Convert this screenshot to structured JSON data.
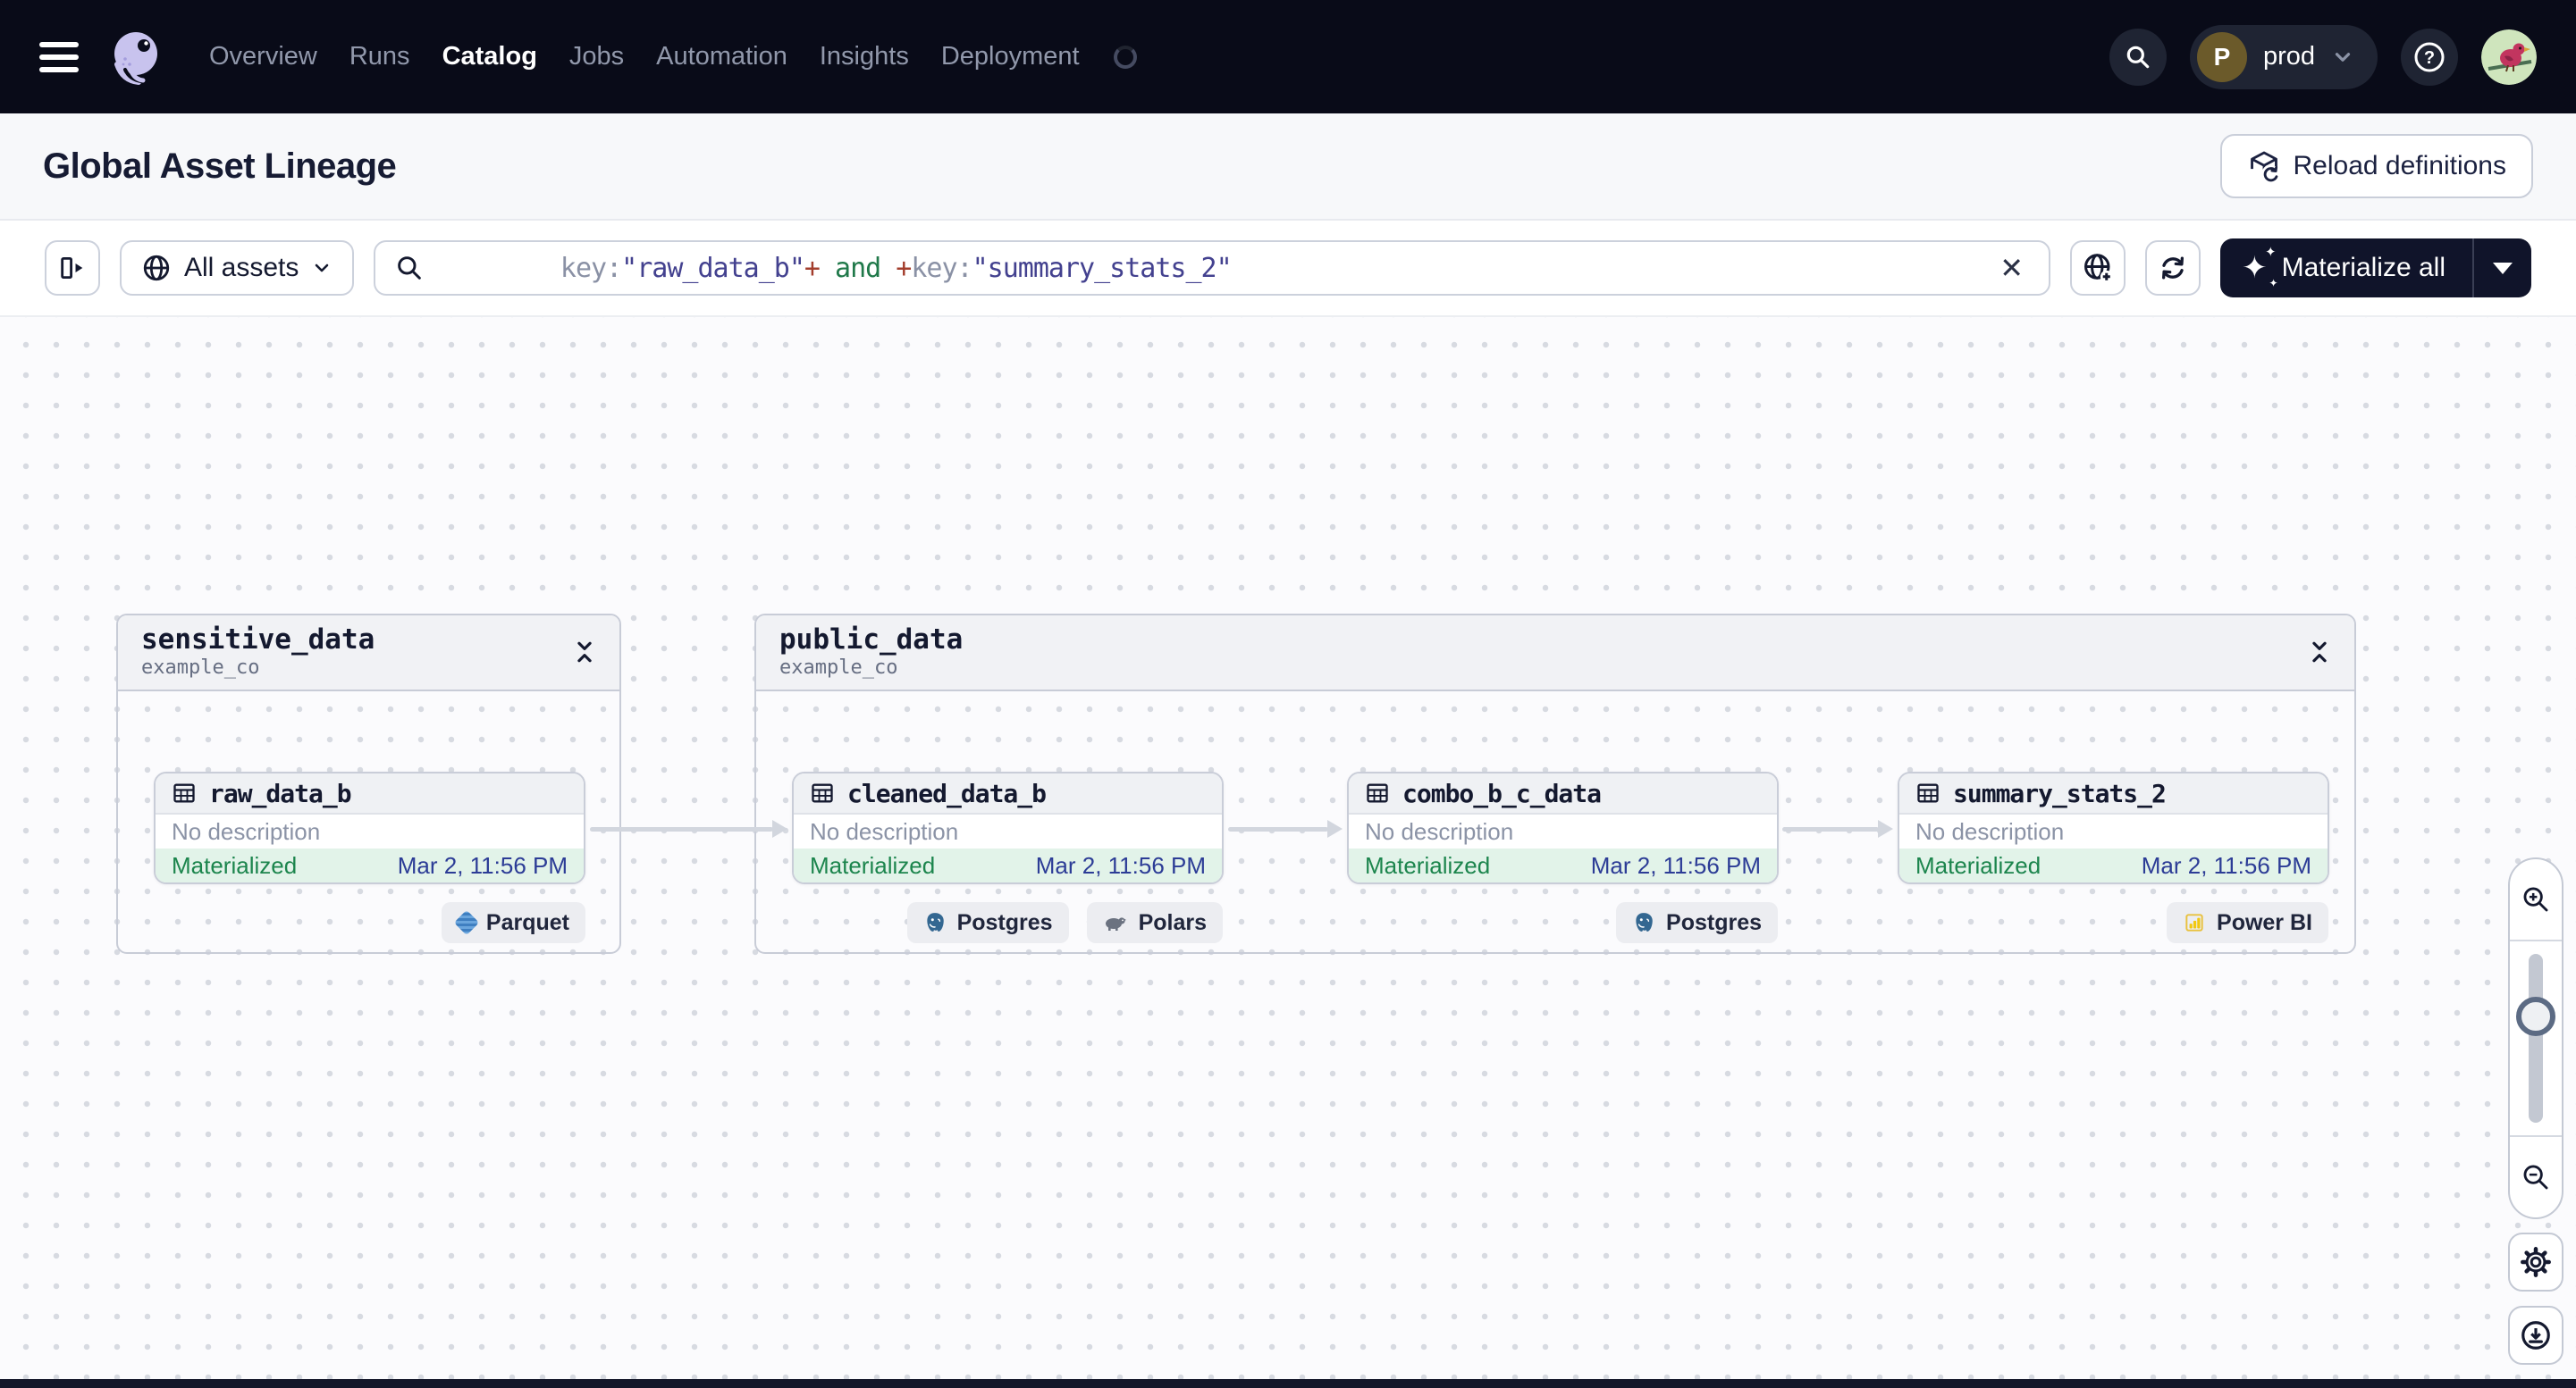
{
  "nav": {
    "items": [
      "Overview",
      "Runs",
      "Catalog",
      "Jobs",
      "Automation",
      "Insights",
      "Deployment"
    ],
    "active_item": "Catalog",
    "deployment_switcher": {
      "avatar_letter": "P",
      "label": "prod"
    },
    "help_glyph": "?"
  },
  "page_header": {
    "title": "Global Asset Lineage",
    "reload_button_label": "Reload definitions"
  },
  "toolbar": {
    "scope_button_label": "All assets",
    "search_query_segments": [
      {
        "text": "key:",
        "color": "#8a91a5"
      },
      {
        "text": "\"raw_data_b\"",
        "color": "#43418f"
      },
      {
        "text": "+",
        "color": "#a33d2c"
      },
      {
        "text": " and ",
        "color": "#20794a"
      },
      {
        "text": "+",
        "color": "#a33d2c"
      },
      {
        "text": "key:",
        "color": "#8a91a5"
      },
      {
        "text": "\"summary_stats_2\"",
        "color": "#43418f"
      }
    ],
    "clear_glyph": "✕",
    "materialize_icon_glyph": "✦",
    "materialize_button_label": "Materialize all"
  },
  "graph": {
    "groups": [
      {
        "name": "sensitive_data",
        "location": "example_co"
      },
      {
        "name": "public_data",
        "location": "example_co"
      }
    ],
    "nodes": [
      {
        "name": "raw_data_b",
        "description": "No description",
        "status": "Materialized",
        "materialized_at": "Mar 2, 11:56 PM",
        "badges": [
          {
            "label": "Parquet",
            "icon": "parquet-icon"
          }
        ]
      },
      {
        "name": "cleaned_data_b",
        "description": "No description",
        "status": "Materialized",
        "materialized_at": "Mar 2, 11:56 PM",
        "badges": [
          {
            "label": "Postgres",
            "icon": "postgres-icon"
          },
          {
            "label": "Polars",
            "icon": "polars-icon"
          }
        ]
      },
      {
        "name": "combo_b_c_data",
        "description": "No description",
        "status": "Materialized",
        "materialized_at": "Mar 2, 11:56 PM",
        "badges": [
          {
            "label": "Postgres",
            "icon": "postgres-icon"
          }
        ]
      },
      {
        "name": "summary_stats_2",
        "description": "No description",
        "status": "Materialized",
        "materialized_at": "Mar 2, 11:56 PM",
        "badges": [
          {
            "label": "Power BI",
            "icon": "powerbi-icon"
          }
        ]
      }
    ]
  },
  "colors": {
    "nav_background": "#090b18",
    "materialize_background": "#10142a",
    "status_text": "#1c854d",
    "status_background": "#e2f3e9",
    "timestamp_text": "#2c3c96",
    "edge": "#d2d6de"
  }
}
